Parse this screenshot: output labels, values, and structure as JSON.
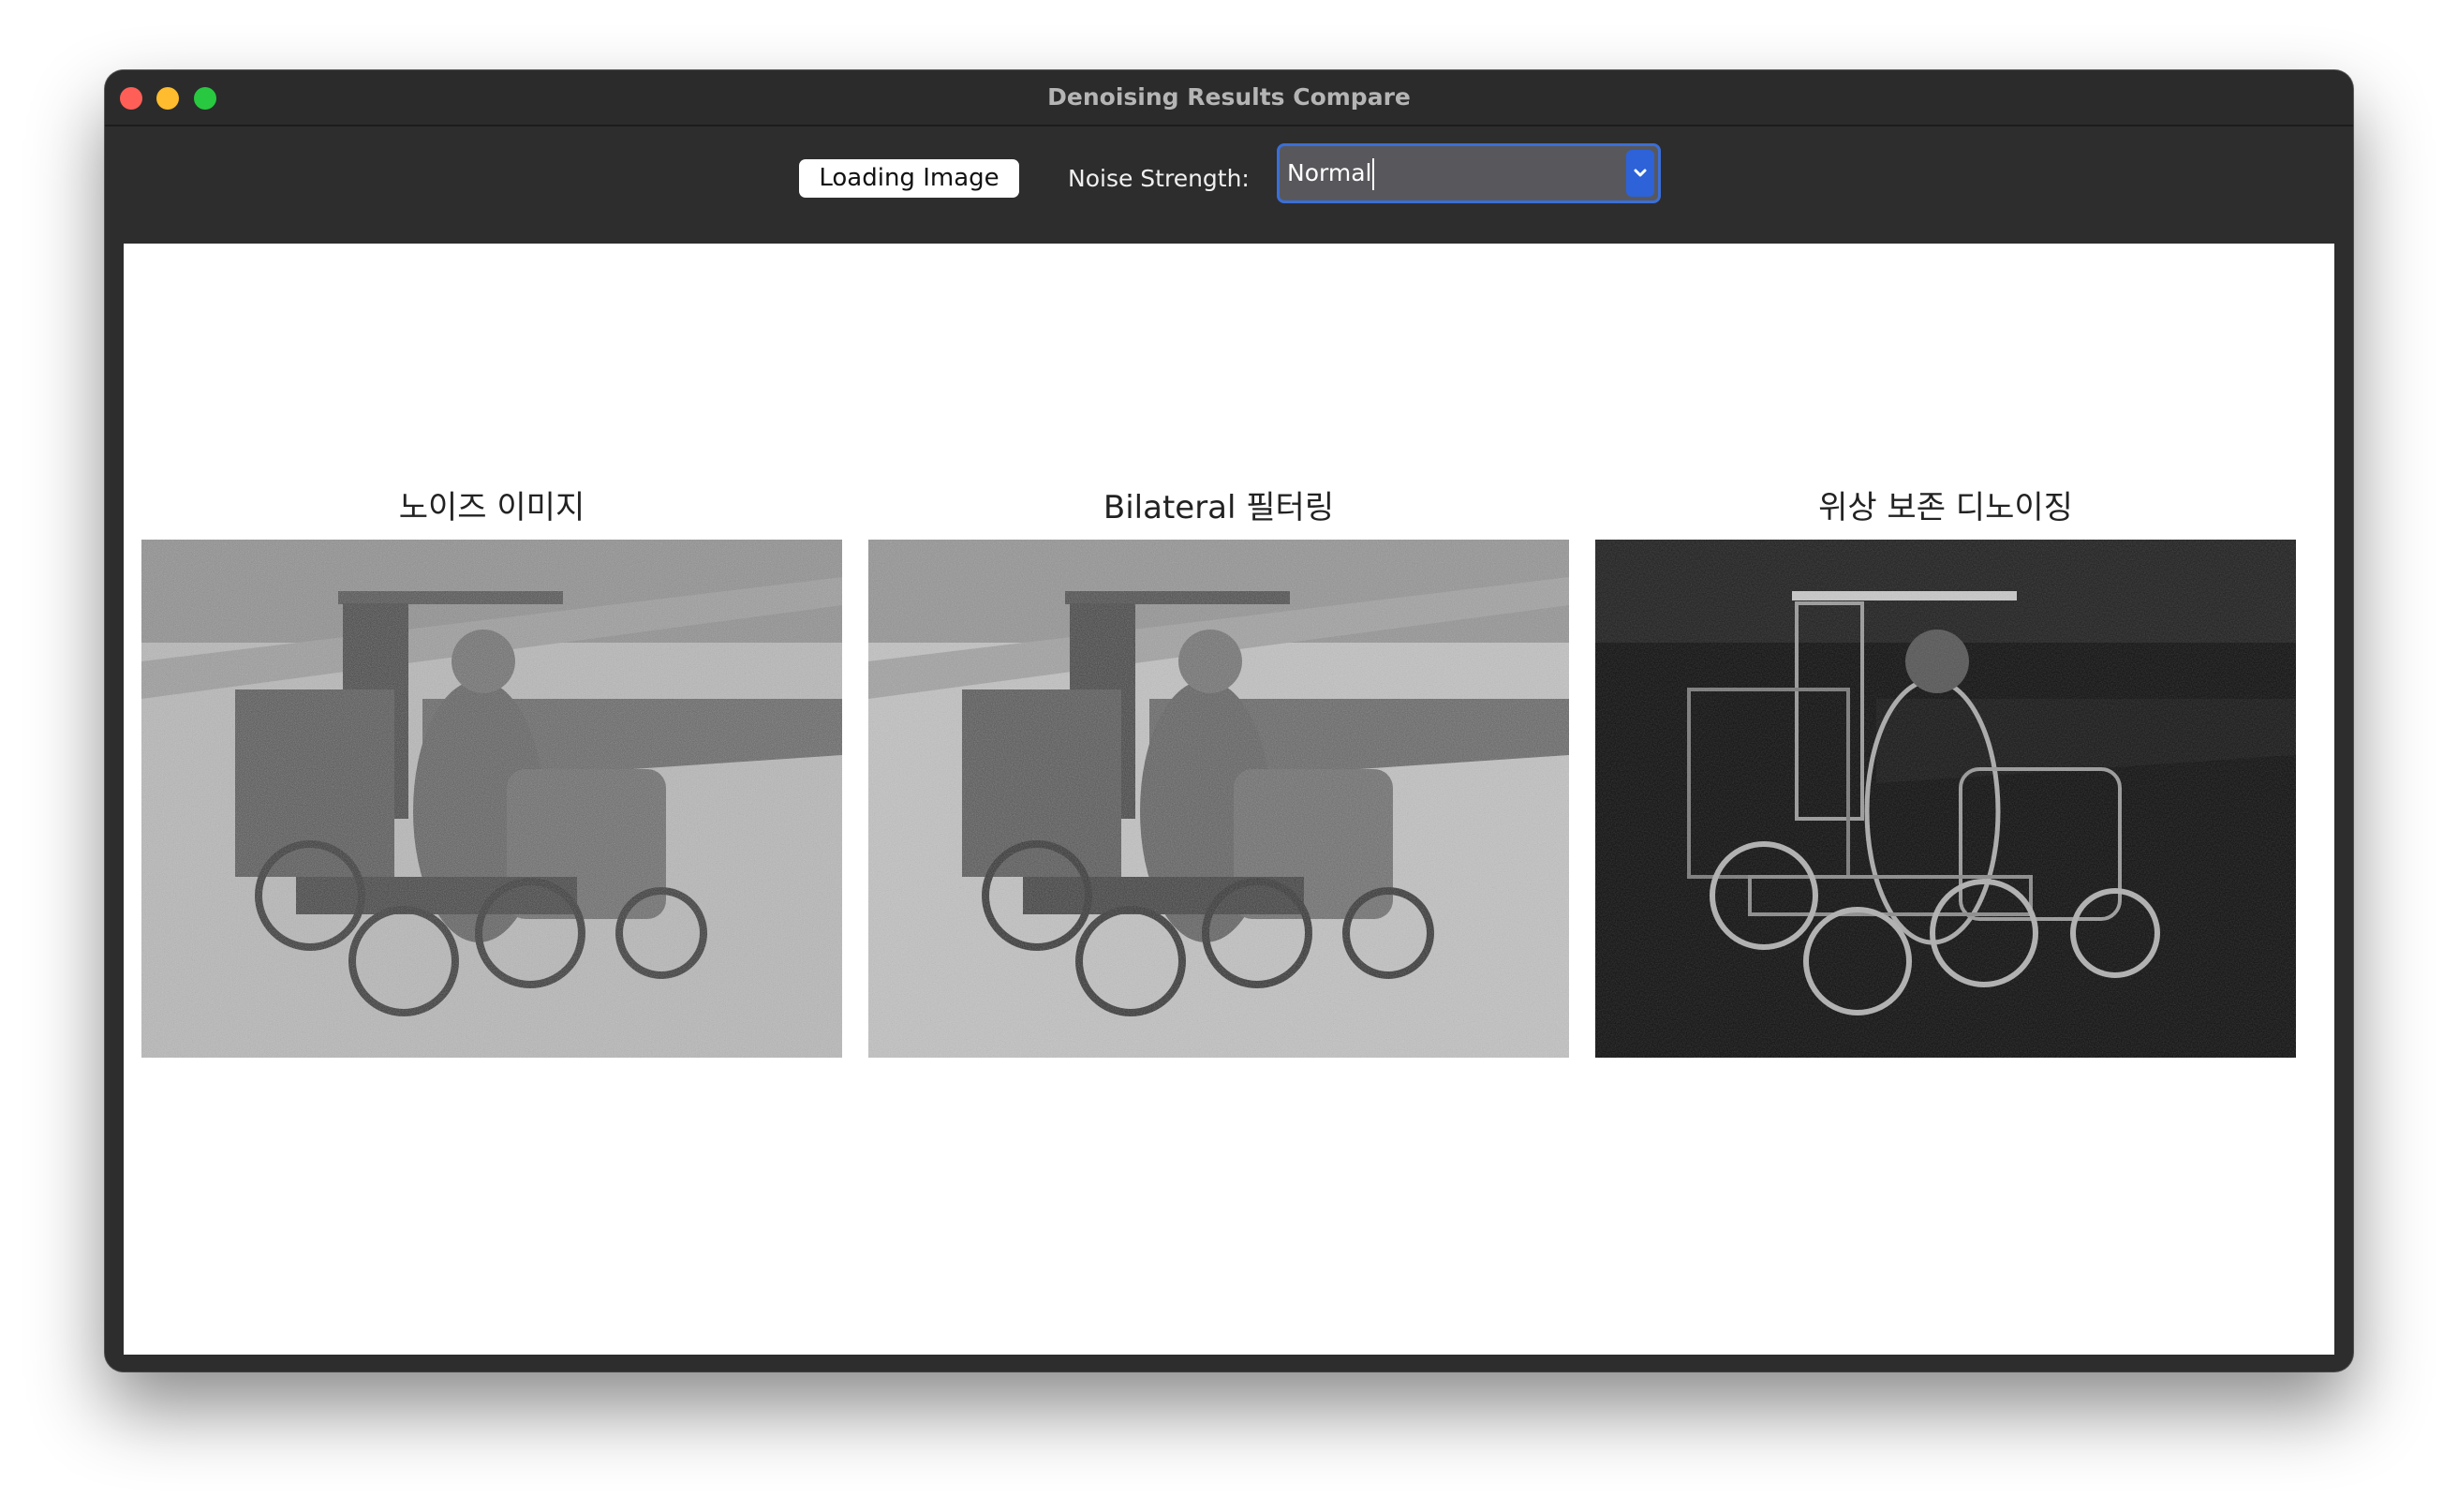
{
  "window": {
    "title": "Denoising Results Compare"
  },
  "toolbar": {
    "load_button_label": "Loading Image",
    "noise_label": "Noise Strength:",
    "noise_selected": "Normal"
  },
  "panels": [
    {
      "title": "노이즈 이미지",
      "image": "noisy-car-photo"
    },
    {
      "title": "Bilateral 필터링",
      "image": "bilateral-filtered-car-photo"
    },
    {
      "title": "위상 보존 디노이징",
      "image": "phase-preserving-denoised-car-photo"
    }
  ],
  "colors": {
    "titlebar": "#2b2b2b",
    "toolbar": "#2d2d2d",
    "combo_accent": "#2d62d8",
    "close": "#ff5f57",
    "minimize": "#febc2e",
    "maximize": "#28c840"
  }
}
